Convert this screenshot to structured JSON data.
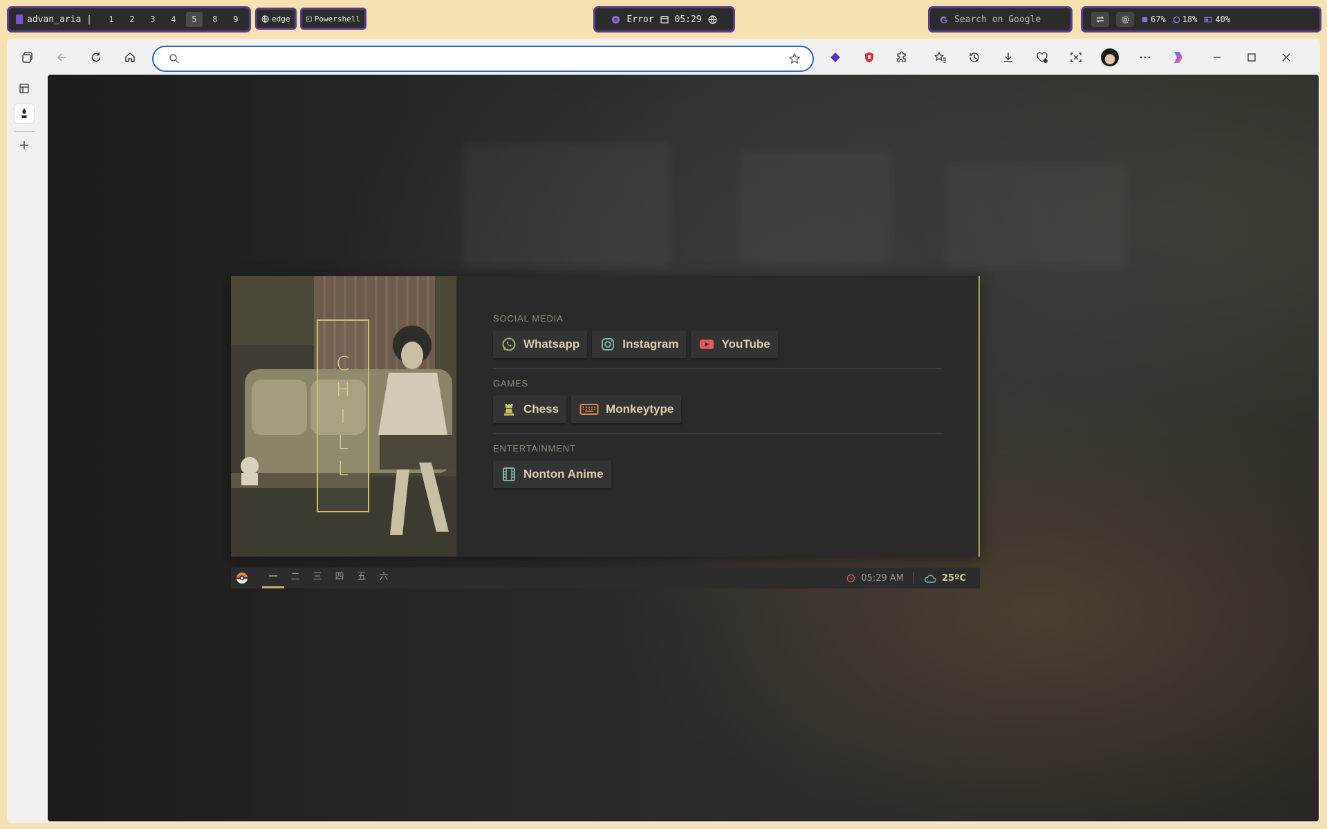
{
  "desktop_bar": {
    "workspace_name": "advan_aria |",
    "workspaces": [
      "1",
      "2",
      "3",
      "4",
      "5",
      "8",
      "9"
    ],
    "active_workspace": "5",
    "apps": [
      "edge",
      "Powershell"
    ],
    "status_text": "Error",
    "clock": "05:29",
    "search_placeholder": "Search on Google",
    "cpu": "67%",
    "ram": "18%",
    "battery": "40%"
  },
  "browser": {
    "address_value": "",
    "address_placeholder": ""
  },
  "page": {
    "banner_letters": [
      "C",
      "H",
      "I",
      "L",
      "L"
    ],
    "sections": [
      {
        "title": "SOCIAL MEDIA",
        "links": [
          {
            "label": "Whatsapp",
            "icon": "whatsapp-icon"
          },
          {
            "label": "Instagram",
            "icon": "instagram-icon"
          },
          {
            "label": "YouTube",
            "icon": "youtube-icon"
          }
        ]
      },
      {
        "title": "GAMES",
        "links": [
          {
            "label": "Chess",
            "icon": "chess-icon"
          },
          {
            "label": "Monkeytype",
            "icon": "keyboard-icon"
          }
        ]
      },
      {
        "title": "ENTERTAINMENT",
        "links": [
          {
            "label": "Nonton Anime",
            "icon": "film-icon"
          }
        ]
      }
    ],
    "bottom_bar": {
      "tabs": [
        "一",
        "二",
        "三",
        "四",
        "五",
        "六"
      ],
      "active_tab": "一",
      "time": "05:29 AM",
      "temperature": "25ºC"
    }
  },
  "colors": {
    "accent_yellow": "#c9c36a",
    "link_text": "#dccdb2",
    "whatsapp": "#9bb36a",
    "instagram": "#7fb2a8",
    "youtube": "#e05a5a",
    "chess": "#c7c06a",
    "keyboard": "#e0874a",
    "film": "#7fb2a8"
  }
}
